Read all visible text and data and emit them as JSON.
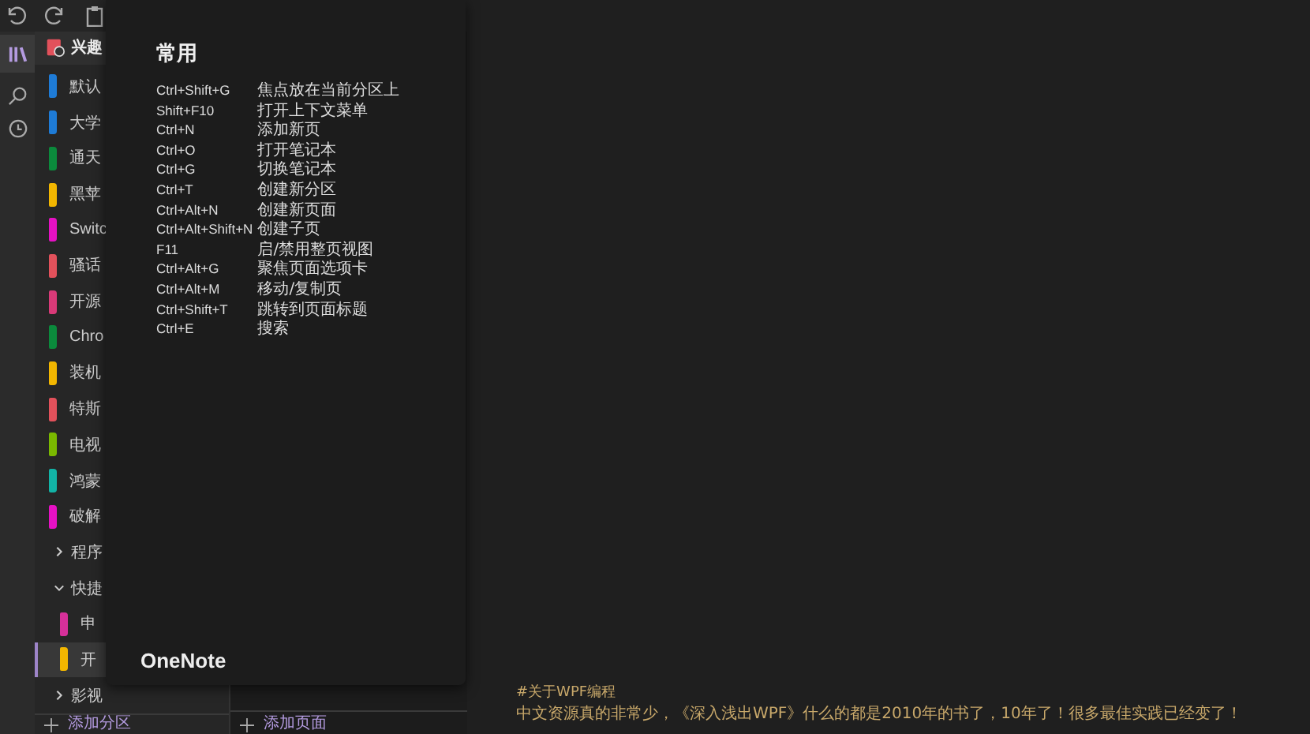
{
  "notebook": {
    "name": "兴趣"
  },
  "sections": [
    {
      "kind": "section",
      "name": "默认",
      "color": "#1e7bd6",
      "selected": false
    },
    {
      "kind": "section",
      "name": "大学",
      "color": "#1e7bd6",
      "selected": false
    },
    {
      "kind": "section",
      "name": "通天",
      "color": "#0b8a3c",
      "selected": false
    },
    {
      "kind": "section",
      "name": "黑苹",
      "color": "#f2b600",
      "selected": false
    },
    {
      "kind": "section",
      "name": "Switc",
      "color": "#e611c4",
      "selected": false
    },
    {
      "kind": "section",
      "name": "骚话",
      "color": "#e2515b",
      "selected": false
    },
    {
      "kind": "section",
      "name": "开源",
      "color": "#d93a78",
      "selected": false
    },
    {
      "kind": "section",
      "name": "Chro",
      "color": "#0b8a3c",
      "selected": false
    },
    {
      "kind": "section",
      "name": "装机",
      "color": "#f2b600",
      "selected": false
    },
    {
      "kind": "section",
      "name": "特斯",
      "color": "#e2515b",
      "selected": false
    },
    {
      "kind": "section",
      "name": "电视",
      "color": "#7ab800",
      "selected": false
    },
    {
      "kind": "section",
      "name": "鸿蒙",
      "color": "#12b3a6",
      "selected": false
    },
    {
      "kind": "section",
      "name": "破解",
      "color": "#e611c4",
      "selected": false
    },
    {
      "kind": "group",
      "name": "程序",
      "expanded": false
    },
    {
      "kind": "group",
      "name": "快捷",
      "expanded": true,
      "children": [
        {
          "kind": "section",
          "name": "申",
          "color": "#d6309a",
          "selected": false
        },
        {
          "kind": "section",
          "name": "开",
          "color": "#f2b600",
          "selected": true
        }
      ]
    },
    {
      "kind": "group",
      "name": "影视",
      "expanded": false
    }
  ],
  "add_section": "添加分区",
  "add_page": "添加页面",
  "shortcuts_panel": {
    "heading": "常用",
    "footer": "OneNote",
    "shortcuts": [
      {
        "keys": "Ctrl+Shift+G",
        "action": "焦点放在当前分区上"
      },
      {
        "keys": "Shift+F10",
        "action": "打开上下文菜单"
      },
      {
        "keys": "Ctrl+N",
        "action": "添加新页"
      },
      {
        "keys": "Ctrl+O",
        "action": "打开笔记本"
      },
      {
        "keys": "Ctrl+G",
        "action": "切换笔记本"
      },
      {
        "keys": "Ctrl+T",
        "action": "创建新分区"
      },
      {
        "keys": "Ctrl+Alt+N",
        "action": "创建新页面"
      },
      {
        "keys": "Ctrl+Alt+Shift+N",
        "action": "创建子页"
      },
      {
        "keys": "F11",
        "action": "启/禁用整页视图"
      },
      {
        "keys": "Ctrl+Alt+G",
        "action": "聚焦页面选项卡"
      },
      {
        "keys": "Ctrl+Alt+M",
        "action": "移动/复制页"
      },
      {
        "keys": "Ctrl+Shift+T",
        "action": "跳转到页面标题"
      },
      {
        "keys": "Ctrl+E",
        "action": "搜索"
      }
    ]
  },
  "page_content": [
    "#关于WPF编程",
    "中文资源真的非常少，《深入浅出WPF》什么的都是2010年的书了，10年了！很多最佳实践已经变了！"
  ]
}
